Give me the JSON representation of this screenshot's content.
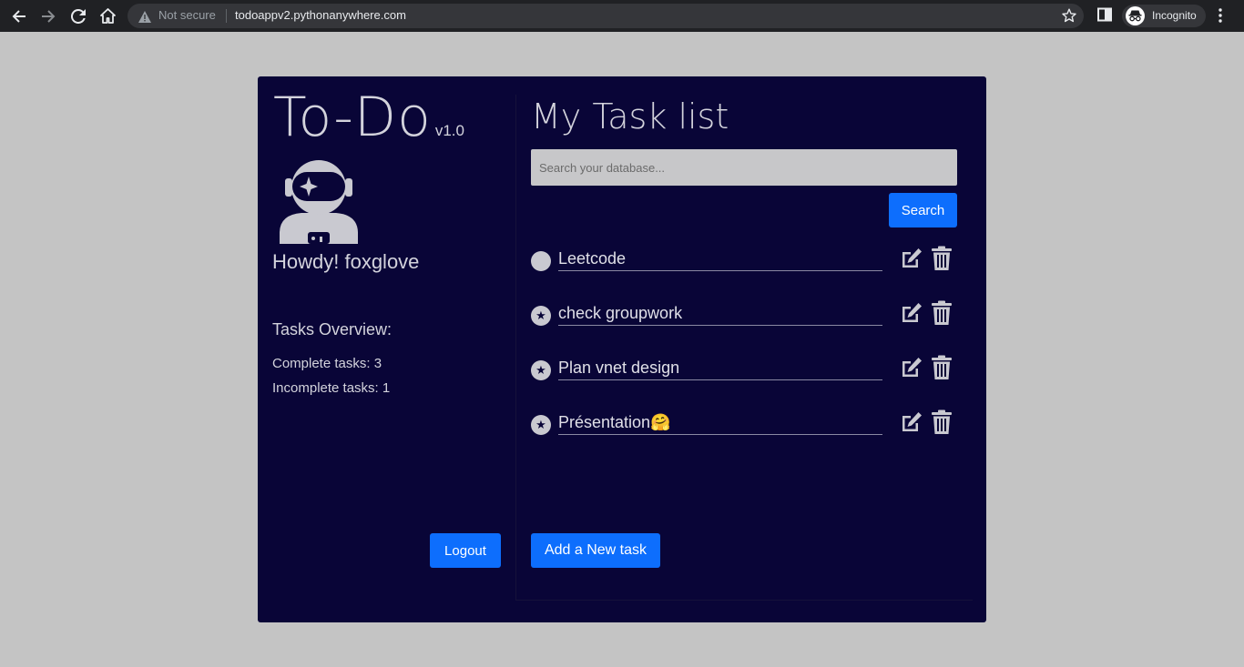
{
  "browser": {
    "security": "Not secure",
    "url": "todoappv2.pythonanywhere.com",
    "profile": "Incognito"
  },
  "sidebar": {
    "title": "To-Do",
    "version": "v1.0",
    "greeting": "Howdy! foxglove",
    "overview_title": "Tasks Overview:",
    "complete": "Complete tasks: 3",
    "incomplete": "Incomplete tasks: 1",
    "logout": "Logout"
  },
  "main": {
    "title": "My Task list",
    "search_placeholder": "Search your database...",
    "search_button": "Search",
    "add_button": "Add a New task",
    "tasks": [
      {
        "name": "Leetcode",
        "status": "incomplete"
      },
      {
        "name": "check groupwork",
        "status": "complete"
      },
      {
        "name": "Plan vnet design",
        "status": "complete"
      },
      {
        "name": "Présentation🤗",
        "status": "complete"
      }
    ]
  },
  "colors": {
    "page_bg": "#c4c4c4",
    "card_bg": "#090537",
    "accent": "#0d6efd",
    "text": "#d3d3dc"
  }
}
